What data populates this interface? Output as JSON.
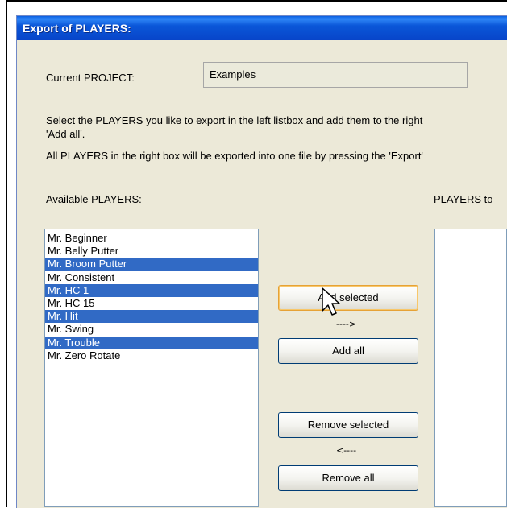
{
  "dialog": {
    "title": "Export of PLAYERS:",
    "current_project_label": "Current PROJECT:",
    "current_project_value": "Examples",
    "instruction_1": "Select the PLAYERS you like to export in the left listbox and add them to the right",
    "instruction_1b": "'Add all'.",
    "instruction_2": "All PLAYERS in the right box will be exported into one file by pressing the 'Export'",
    "available_label": "Available PLAYERS:",
    "selected_label": "PLAYERS to"
  },
  "available_players": [
    {
      "name": "Mr. Beginner",
      "selected": false
    },
    {
      "name": "Mr. Belly Putter",
      "selected": false
    },
    {
      "name": "Mr. Broom Putter",
      "selected": true
    },
    {
      "name": "Mr. Consistent",
      "selected": false
    },
    {
      "name": "Mr. HC 1",
      "selected": true
    },
    {
      "name": "Mr. HC 15",
      "selected": false
    },
    {
      "name": "Mr. Hit",
      "selected": true
    },
    {
      "name": "Mr. Swing",
      "selected": false
    },
    {
      "name": "Mr. Trouble",
      "selected": true
    },
    {
      "name": "Mr. Zero Rotate",
      "selected": false
    }
  ],
  "buttons": {
    "add_selected": "Add selected",
    "add_all": "Add all",
    "remove_selected": "Remove selected",
    "remove_all": "Remove all"
  },
  "arrows": {
    "add": "---->",
    "remove": "<----"
  },
  "colors": {
    "title_bar": "#0a56d8",
    "selection": "#316ac5",
    "dialog_bg": "#ece9d8"
  }
}
